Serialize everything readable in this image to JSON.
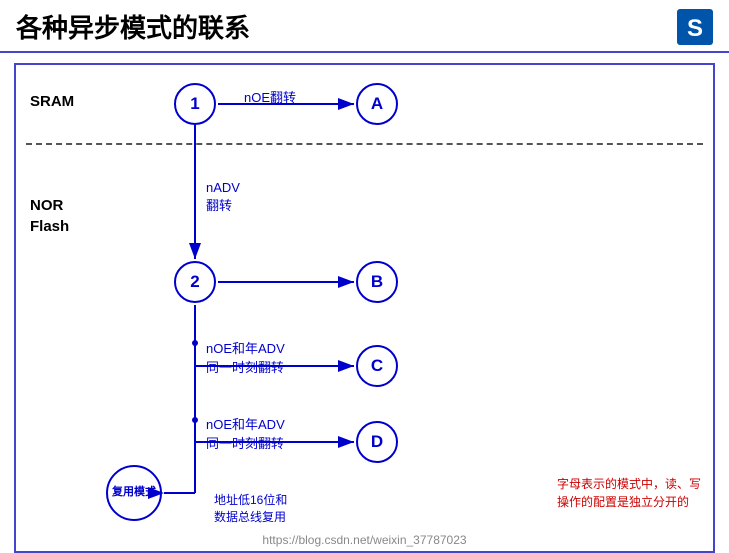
{
  "header": {
    "title": "各种异步模式的联系",
    "logo_text": "S"
  },
  "diagram": {
    "sram_label": "SRAM",
    "nor_flash_label": "NOR\nFlash",
    "node1_label": "1",
    "node2_label": "2",
    "nodeA_label": "A",
    "nodeB_label": "B",
    "nodeC_label": "C",
    "nodeD_label": "D",
    "mux_label": "复用模式",
    "arrow_noe": "nOE翻转",
    "arrow_nadv": "nADV\n翻转",
    "arrow_noe_adv1": "nOE和年ADV\n同一时刻翻转",
    "arrow_noe_adv2": "nOE和年ADV\n同一时刻翻转",
    "arrow_mux": "地址低16位和\n数据总线复用",
    "note": "字母表示的模式中，读、写\n操作的配置是独立分开的",
    "watermark": "https://blog.csdn.net/weixin_37787023"
  }
}
